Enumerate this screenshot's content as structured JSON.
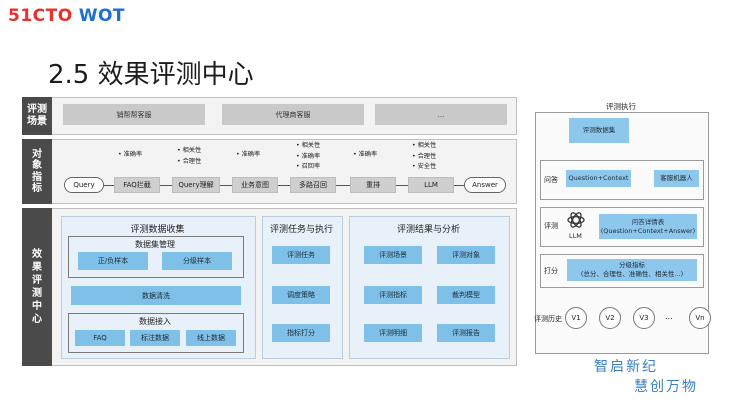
{
  "logo": {
    "part1": "51CTO",
    "part2": "WOT"
  },
  "title": "2.5 效果评测中心",
  "scene": {
    "label": "评测\n场景",
    "items": [
      "销帮帮客服",
      "代理商客服",
      "..."
    ]
  },
  "objects": {
    "label": "对\n象\n指\n标",
    "nodes": [
      "Query",
      "FAQ拦截",
      "Query理解",
      "业务意图",
      "多路召回",
      "重排",
      "LLM",
      "Answer"
    ],
    "metrics": [
      {
        "stage": "FAQ拦截",
        "items": [
          "准确率"
        ]
      },
      {
        "stage": "Query理解",
        "items": [
          "相关性",
          "合理性"
        ]
      },
      {
        "stage": "业务意图",
        "items": [
          "准确率"
        ]
      },
      {
        "stage": "多路召回",
        "items": [
          "相关性",
          "准确率",
          "召回率"
        ]
      },
      {
        "stage": "重排",
        "items": [
          "准确率"
        ]
      },
      {
        "stage": "LLM",
        "items": [
          "相关性",
          "合理性",
          "安全性"
        ]
      }
    ]
  },
  "system": {
    "label": "效\n果\n评\n测\n中\n心",
    "collect": {
      "title": "评测数据收集",
      "manage": {
        "title": "数据集管理",
        "items": [
          "正/负样本",
          "分级样本"
        ]
      },
      "clean": "数据清洗",
      "access": {
        "title": "数据接入",
        "items": [
          "FAQ",
          "标注数据",
          "线上数据"
        ]
      }
    },
    "tasks": {
      "title": "评测任务与执行",
      "items": [
        "评测任务",
        "调度策略",
        "指标打分"
      ]
    },
    "results": {
      "title": "评测结果与分析",
      "items": [
        "评测场景",
        "评测对象",
        "评测指标",
        "裁判模型",
        "评测明细",
        "评测报告"
      ]
    }
  },
  "flow": {
    "title": "评测执行",
    "dataset": "评测数据集",
    "qa_label": "问答",
    "question": "Question+Context",
    "robot": "客服机器人",
    "eval_label": "评测",
    "llm": "LLM",
    "detail": "问答详情表\n(Question+Context+Answer)",
    "score_label": "打分",
    "score": "分级指标\n(总分、合理性、准确性、相关性...)",
    "history_label": "评测历史",
    "versions": [
      "V1",
      "V2",
      "V3",
      "...",
      "Vn"
    ]
  },
  "slogan": {
    "line1": "智启新纪",
    "line2": "慧创万物"
  }
}
